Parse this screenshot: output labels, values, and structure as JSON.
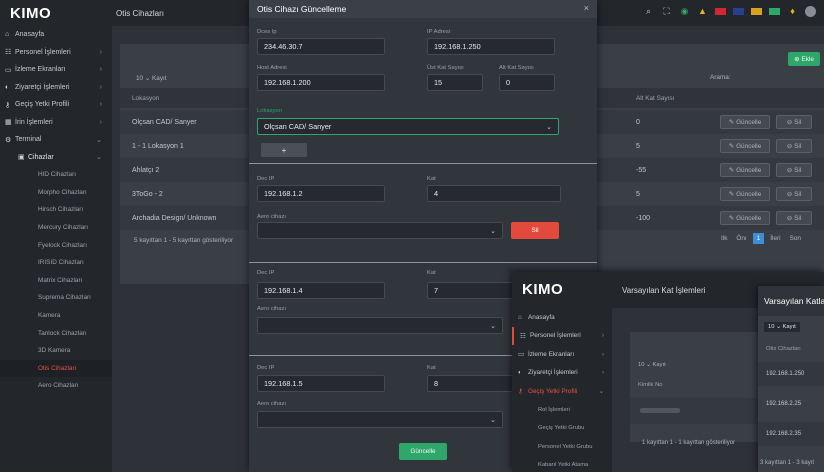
{
  "app": {
    "logo": "KIMO",
    "title": "Otis Cihazları"
  },
  "sidebar": {
    "items": [
      {
        "icon": "home-icon",
        "glyph": "⌂",
        "label": "Anasayfa"
      },
      {
        "icon": "users-icon",
        "glyph": "☷",
        "label": "Personel İşlemleri"
      },
      {
        "icon": "monitor-icon",
        "glyph": "▭",
        "label": "İzleme Ekranları"
      },
      {
        "icon": "palette-icon",
        "glyph": "◐",
        "label": "Ziyaretçi İşlemleri"
      },
      {
        "icon": "key-icon",
        "glyph": "⚷",
        "label": "Geçiş Yetki Profili"
      },
      {
        "icon": "building-icon",
        "glyph": "▦",
        "label": "İrin İşlemleri"
      },
      {
        "icon": "gear-icon",
        "glyph": "⚙",
        "label": "Terminal"
      }
    ],
    "subhead": "Cihazlar",
    "subs": [
      "HID Cihazları",
      "Morpho Cihazları",
      "Hirsch Cihazları",
      "Mercury Cihazları",
      "Fyelock Cihazları",
      "IRISID Cihazları",
      "Matrix Cihazları",
      "Suprema Cihazları",
      "Kamera",
      "Tanlock Cihazları",
      "3D Kamera",
      "Otis Cihazları",
      "Aero Cihazları"
    ]
  },
  "bg_page": {
    "add_label": "Ekle",
    "page_size": "10",
    "page_size_suffix": "Kayıt",
    "search_label": "Arama:",
    "col_location": "Lokasyon",
    "col_top": "Alt Kat Sayısı",
    "rows": [
      {
        "loc": "Olçsan CAD/ Sanyer",
        "val": "0"
      },
      {
        "loc": "1 - 1 Lokasyon 1",
        "val": "5"
      },
      {
        "loc": "Ahlatçı 2",
        "val": "-55"
      },
      {
        "loc": "3ToGo - 2",
        "val": "5"
      },
      {
        "loc": "Archadia Design/ Unknown",
        "val": "-100"
      }
    ],
    "update_label": "Güncelle",
    "delete_label": "Sil",
    "footer": "5 kayıttan 1 - 5 kayıttan gösteriliyor",
    "pager": [
      "Ilk",
      "Önı",
      "1",
      "İleri",
      "Son"
    ]
  },
  "modal": {
    "title": "Otis Cihazı Güncelleme",
    "l_client": "Dces Ip",
    "client_ip": "234.46.30.7",
    "l_ip": "IP Adresi",
    "ip": "192.168.1.250",
    "l_host": "Host Adresi",
    "host": "192.168.1.200",
    "l_top": "Üst Kat Sayısı",
    "top": "15",
    "l_bottom": "Alt Kat Sayısı",
    "bottom": "0",
    "l_location": "Lokasyon",
    "location": "Olçsan CAD/ Sanyer",
    "plus": "+",
    "l_dec": "Dec IP",
    "l_floor": "Kat",
    "l_cihaz": "Aero cihazı",
    "blocks": [
      {
        "dec": "192.168.1.2",
        "floor": "4"
      },
      {
        "dec": "192.168.1.4",
        "floor": "7"
      },
      {
        "dec": "192.168.1.5",
        "floor": "8"
      }
    ],
    "delete_label": "Sil",
    "submit_label": "Güncelle"
  },
  "win2": {
    "logo": "KIMO",
    "title": "Varsayılan Kat İşlemleri",
    "items": [
      {
        "icon": "home-icon",
        "glyph": "⌂",
        "label": "Anasayfa"
      },
      {
        "icon": "users-icon",
        "glyph": "☷",
        "label": "Personel İşlemleri"
      },
      {
        "icon": "monitor-icon",
        "glyph": "▭",
        "label": "İzleme Ekranları"
      },
      {
        "icon": "palette-icon",
        "glyph": "◐",
        "label": "Ziyaretçi İşlemleri"
      },
      {
        "icon": "key-icon",
        "glyph": "⚷",
        "label": "Geçiş Yetki Profili"
      }
    ],
    "subs": [
      "Rol İşlemleri",
      "Geçiş Yetki Grubu",
      "Personel Yetki Grubu",
      "Kabarıl Yetki Atama"
    ],
    "page_size": "10",
    "page_size_suffix": "Kayıt",
    "col": "Kimlik No",
    "footer": "1 kayıttan 1 - 1 kayıttan gösteriliyor"
  },
  "win3": {
    "title": "Varsayılan Katlar",
    "page_size": "10",
    "page_size_suffix": "Kayıt",
    "col": "Otis Cihazları",
    "rows": [
      "192.168.1.250",
      "192.168.2.25",
      "192.168.2.35"
    ],
    "footer": "3 kayıttan 1 - 3 kayıt"
  },
  "colors": {
    "accent": "#2fa66a",
    "danger": "#e24a3b",
    "active": "#e8553e"
  }
}
